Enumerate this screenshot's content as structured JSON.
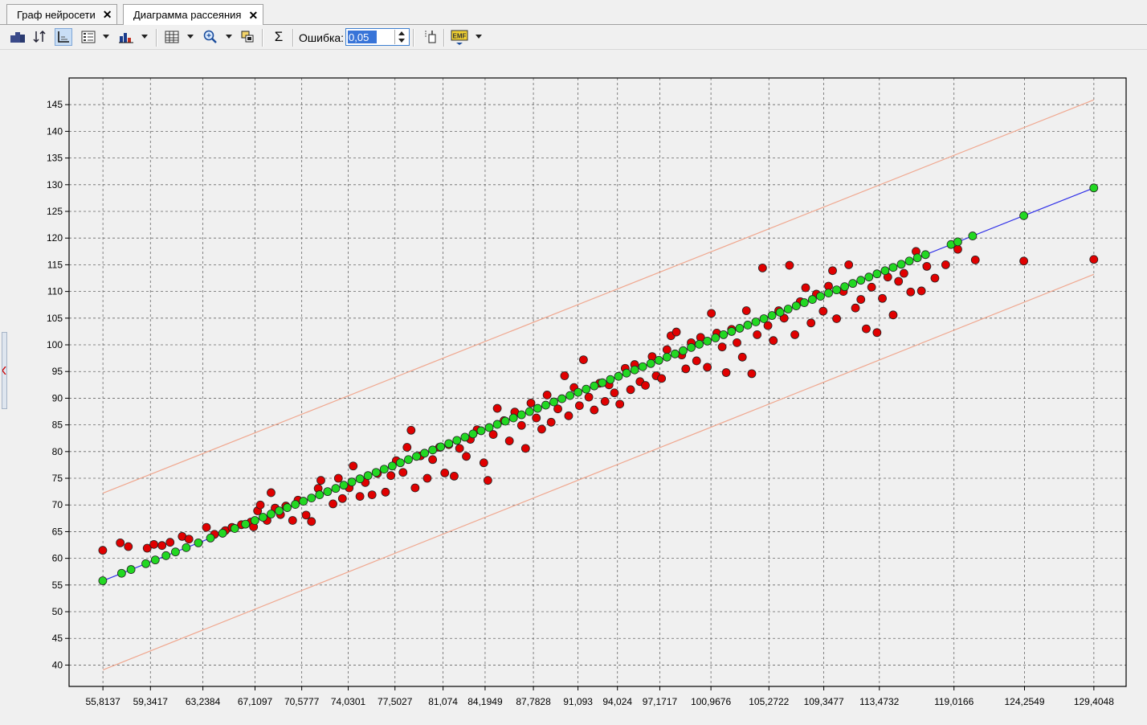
{
  "tabs": [
    {
      "label": "Граф нейросети",
      "close": "✕"
    },
    {
      "label": "Диаграмма рассеяния",
      "close": "✕"
    }
  ],
  "toolbar": {
    "icons": [
      "network-icon",
      "sort-icon",
      "axes-icon",
      "list-view-icon",
      "bar-chart-icon",
      "table-icon",
      "zoom-icon",
      "layers-icon",
      "sigma-icon",
      "pointer-icon",
      "emf-export-icon"
    ],
    "sigma": "Σ",
    "error_label": "Ошибка:",
    "error_value": "0,05",
    "emf": "EMF"
  },
  "colors": {
    "actual_point": "#e00000",
    "predicted_point": "#22d822",
    "regression_line": "#3030e8",
    "confidence_band": "#f0a890",
    "plot_bg": "#f0f0f0",
    "grid": "#666666"
  },
  "chart_data": {
    "type": "scatter",
    "title": "",
    "xlabel": "",
    "ylabel": "",
    "grid": true,
    "legend": "none",
    "ylim": [
      36,
      150
    ],
    "xlim": [
      53.3,
      131.8
    ],
    "y_ticks": [
      40,
      45,
      50,
      55,
      60,
      65,
      70,
      75,
      80,
      85,
      90,
      95,
      100,
      105,
      110,
      115,
      120,
      125,
      130,
      135,
      140,
      145
    ],
    "x_ticks": [
      {
        "label": "55,8137",
        "value": 55.8137
      },
      {
        "label": "59,3417",
        "value": 59.3417
      },
      {
        "label": "63,2384",
        "value": 63.2384
      },
      {
        "label": "67,1097",
        "value": 67.1097
      },
      {
        "label": "70,5777",
        "value": 70.5777
      },
      {
        "label": "74,0301",
        "value": 74.0301
      },
      {
        "label": "77,5027",
        "value": 77.5027
      },
      {
        "label": "81,074",
        "value": 81.074
      },
      {
        "label": "84,1949",
        "value": 84.1949
      },
      {
        "label": "87,7828",
        "value": 87.7828
      },
      {
        "label": "91,093",
        "value": 91.093
      },
      {
        "label": "94,024",
        "value": 94.024
      },
      {
        "label": "97,1717",
        "value": 97.1717
      },
      {
        "label": "100,9676",
        "value": 100.9676
      },
      {
        "label": "105,2722",
        "value": 105.2722
      },
      {
        "label": "109,3477",
        "value": 109.3477
      },
      {
        "label": "113,4732",
        "value": 113.4732
      },
      {
        "label": "119,0166",
        "value": 119.0166
      },
      {
        "label": "124,2549",
        "value": 124.2549
      },
      {
        "label": "129,4048",
        "value": 129.4048
      }
    ],
    "regression_line": [
      [
        55.8137,
        55.8
      ],
      [
        129.4048,
        129.4
      ]
    ],
    "upper_band": [
      [
        55.8137,
        72.2
      ],
      [
        129.4048,
        145.9
      ]
    ],
    "lower_band": [
      [
        55.8137,
        39.1
      ],
      [
        129.4048,
        113.2
      ]
    ],
    "series": [
      {
        "role": "actual",
        "color": "#e00000",
        "points": [
          [
            55.8,
            61.5
          ],
          [
            57.1,
            62.9
          ],
          [
            57.7,
            62.2
          ],
          [
            59.1,
            61.9
          ],
          [
            59.6,
            62.6
          ],
          [
            60.2,
            62.4
          ],
          [
            60.8,
            63.0
          ],
          [
            61.7,
            64.1
          ],
          [
            62.2,
            63.6
          ],
          [
            63.5,
            65.8
          ],
          [
            64.1,
            64.5
          ],
          [
            64.9,
            65.2
          ],
          [
            65.4,
            65.8
          ],
          [
            66.1,
            66.3
          ],
          [
            66.8,
            66.8
          ],
          [
            67.0,
            65.9
          ],
          [
            67.3,
            68.9
          ],
          [
            67.5,
            70.0
          ],
          [
            68.0,
            67.1
          ],
          [
            68.3,
            72.3
          ],
          [
            68.6,
            69.4
          ],
          [
            69.0,
            68.2
          ],
          [
            69.4,
            69.8
          ],
          [
            69.9,
            67.1
          ],
          [
            70.3,
            70.9
          ],
          [
            70.9,
            68.1
          ],
          [
            71.3,
            66.9
          ],
          [
            71.8,
            73.1
          ],
          [
            72.0,
            74.6
          ],
          [
            72.9,
            70.2
          ],
          [
            73.3,
            75.0
          ],
          [
            73.6,
            71.2
          ],
          [
            74.1,
            73.2
          ],
          [
            74.4,
            77.3
          ],
          [
            74.9,
            71.6
          ],
          [
            75.3,
            74.2
          ],
          [
            75.8,
            71.9
          ],
          [
            76.2,
            75.9
          ],
          [
            76.8,
            72.4
          ],
          [
            77.2,
            75.5
          ],
          [
            77.6,
            78.3
          ],
          [
            78.1,
            76.1
          ],
          [
            78.4,
            80.8
          ],
          [
            78.7,
            84.0
          ],
          [
            79.0,
            73.2
          ],
          [
            79.4,
            79.2
          ],
          [
            79.9,
            75.0
          ],
          [
            80.3,
            78.5
          ],
          [
            80.8,
            80.8
          ],
          [
            81.2,
            76.0
          ],
          [
            81.5,
            81.3
          ],
          [
            81.9,
            75.4
          ],
          [
            82.3,
            80.6
          ],
          [
            82.8,
            79.1
          ],
          [
            83.1,
            82.3
          ],
          [
            83.6,
            84.1
          ],
          [
            84.1,
            77.9
          ],
          [
            84.4,
            74.6
          ],
          [
            84.8,
            83.2
          ],
          [
            85.1,
            88.1
          ],
          [
            85.6,
            85.8
          ],
          [
            86.0,
            82.0
          ],
          [
            86.4,
            87.4
          ],
          [
            86.9,
            84.9
          ],
          [
            87.2,
            80.6
          ],
          [
            87.6,
            89.1
          ],
          [
            88.0,
            86.3
          ],
          [
            88.4,
            84.2
          ],
          [
            88.8,
            90.6
          ],
          [
            89.1,
            85.5
          ],
          [
            89.6,
            88.0
          ],
          [
            90.1,
            94.2
          ],
          [
            90.4,
            86.7
          ],
          [
            90.8,
            92.0
          ],
          [
            91.2,
            88.6
          ],
          [
            91.5,
            97.2
          ],
          [
            91.9,
            90.2
          ],
          [
            92.3,
            87.8
          ],
          [
            92.7,
            92.8
          ],
          [
            93.1,
            89.4
          ],
          [
            93.4,
            92.5
          ],
          [
            93.8,
            91.0
          ],
          [
            94.2,
            88.9
          ],
          [
            94.6,
            95.6
          ],
          [
            95.0,
            91.6
          ],
          [
            95.3,
            96.3
          ],
          [
            95.7,
            93.1
          ],
          [
            96.1,
            92.4
          ],
          [
            96.6,
            97.8
          ],
          [
            96.9,
            94.2
          ],
          [
            97.3,
            93.7
          ],
          [
            97.7,
            99.1
          ],
          [
            98.0,
            101.7
          ],
          [
            98.4,
            102.4
          ],
          [
            98.8,
            98.1
          ],
          [
            99.1,
            95.5
          ],
          [
            99.5,
            100.4
          ],
          [
            99.9,
            97.0
          ],
          [
            100.2,
            101.4
          ],
          [
            100.7,
            95.8
          ],
          [
            101.0,
            105.9
          ],
          [
            101.4,
            102.2
          ],
          [
            101.8,
            99.6
          ],
          [
            102.1,
            94.8
          ],
          [
            102.5,
            102.9
          ],
          [
            102.9,
            100.4
          ],
          [
            103.3,
            97.7
          ],
          [
            103.6,
            106.4
          ],
          [
            104.0,
            94.6
          ],
          [
            104.4,
            101.9
          ],
          [
            104.8,
            114.4
          ],
          [
            105.2,
            103.6
          ],
          [
            105.6,
            100.8
          ],
          [
            106.0,
            106.4
          ],
          [
            106.4,
            105.0
          ],
          [
            106.8,
            114.9
          ],
          [
            107.2,
            101.9
          ],
          [
            107.6,
            108.1
          ],
          [
            108.0,
            110.7
          ],
          [
            108.4,
            104.1
          ],
          [
            108.8,
            109.5
          ],
          [
            109.3,
            106.3
          ],
          [
            109.7,
            111.0
          ],
          [
            110.0,
            113.9
          ],
          [
            110.3,
            104.9
          ],
          [
            110.8,
            110.0
          ],
          [
            111.2,
            115.0
          ],
          [
            111.7,
            106.9
          ],
          [
            112.1,
            108.5
          ],
          [
            112.5,
            103.0
          ],
          [
            112.9,
            110.8
          ],
          [
            113.3,
            102.3
          ],
          [
            113.7,
            108.7
          ],
          [
            114.1,
            112.7
          ],
          [
            114.5,
            105.6
          ],
          [
            114.9,
            111.9
          ],
          [
            115.3,
            113.4
          ],
          [
            115.8,
            109.9
          ],
          [
            116.2,
            117.5
          ],
          [
            116.6,
            110.1
          ],
          [
            117.0,
            114.7
          ],
          [
            117.6,
            112.5
          ],
          [
            118.4,
            115.0
          ],
          [
            119.3,
            117.9
          ],
          [
            120.6,
            115.9
          ],
          [
            124.2,
            115.7
          ],
          [
            129.4,
            116.0
          ]
        ]
      },
      {
        "role": "predicted",
        "color": "#22d822",
        "points": [
          [
            55.8,
            55.8
          ],
          [
            57.2,
            57.2
          ],
          [
            57.9,
            57.9
          ],
          [
            59.0,
            59.0
          ],
          [
            59.7,
            59.7
          ],
          [
            60.5,
            60.5
          ],
          [
            61.2,
            61.2
          ],
          [
            62.0,
            62.0
          ],
          [
            62.9,
            62.9
          ],
          [
            63.8,
            63.8
          ],
          [
            64.7,
            64.7
          ],
          [
            65.6,
            65.6
          ],
          [
            66.4,
            66.4
          ],
          [
            67.1,
            67.1
          ],
          [
            67.7,
            67.7
          ],
          [
            68.3,
            68.3
          ],
          [
            68.9,
            68.9
          ],
          [
            69.5,
            69.5
          ],
          [
            70.1,
            70.1
          ],
          [
            70.7,
            70.7
          ],
          [
            71.3,
            71.3
          ],
          [
            71.9,
            71.9
          ],
          [
            72.5,
            72.5
          ],
          [
            73.1,
            73.1
          ],
          [
            73.7,
            73.7
          ],
          [
            74.3,
            74.3
          ],
          [
            74.9,
            74.9
          ],
          [
            75.5,
            75.5
          ],
          [
            76.1,
            76.1
          ],
          [
            76.7,
            76.7
          ],
          [
            77.3,
            77.3
          ],
          [
            77.9,
            77.9
          ],
          [
            78.5,
            78.5
          ],
          [
            79.1,
            79.1
          ],
          [
            79.7,
            79.7
          ],
          [
            80.3,
            80.3
          ],
          [
            80.9,
            80.9
          ],
          [
            81.5,
            81.5
          ],
          [
            82.1,
            82.1
          ],
          [
            82.7,
            82.7
          ],
          [
            83.3,
            83.3
          ],
          [
            83.9,
            83.9
          ],
          [
            84.5,
            84.5
          ],
          [
            85.1,
            85.1
          ],
          [
            85.7,
            85.7
          ],
          [
            86.3,
            86.3
          ],
          [
            86.9,
            86.9
          ],
          [
            87.5,
            87.5
          ],
          [
            88.1,
            88.1
          ],
          [
            88.7,
            88.7
          ],
          [
            89.3,
            89.3
          ],
          [
            89.9,
            89.9
          ],
          [
            90.5,
            90.5
          ],
          [
            91.1,
            91.1
          ],
          [
            91.7,
            91.7
          ],
          [
            92.3,
            92.3
          ],
          [
            92.9,
            92.9
          ],
          [
            93.5,
            93.5
          ],
          [
            94.1,
            94.1
          ],
          [
            94.7,
            94.7
          ],
          [
            95.3,
            95.3
          ],
          [
            95.9,
            95.9
          ],
          [
            96.5,
            96.5
          ],
          [
            97.1,
            97.1
          ],
          [
            97.7,
            97.7
          ],
          [
            98.3,
            98.3
          ],
          [
            98.9,
            98.9
          ],
          [
            99.5,
            99.5
          ],
          [
            100.1,
            100.1
          ],
          [
            100.7,
            100.7
          ],
          [
            101.3,
            101.3
          ],
          [
            101.9,
            101.9
          ],
          [
            102.5,
            102.5
          ],
          [
            103.1,
            103.1
          ],
          [
            103.7,
            103.7
          ],
          [
            104.3,
            104.3
          ],
          [
            104.9,
            104.9
          ],
          [
            105.5,
            105.5
          ],
          [
            106.1,
            106.1
          ],
          [
            106.7,
            106.7
          ],
          [
            107.3,
            107.3
          ],
          [
            107.9,
            107.9
          ],
          [
            108.5,
            108.5
          ],
          [
            109.1,
            109.1
          ],
          [
            109.7,
            109.7
          ],
          [
            110.3,
            110.3
          ],
          [
            110.9,
            110.9
          ],
          [
            111.5,
            111.5
          ],
          [
            112.1,
            112.1
          ],
          [
            112.7,
            112.7
          ],
          [
            113.3,
            113.3
          ],
          [
            113.9,
            113.9
          ],
          [
            114.5,
            114.5
          ],
          [
            115.1,
            115.1
          ],
          [
            115.7,
            115.7
          ],
          [
            116.3,
            116.3
          ],
          [
            116.9,
            116.9
          ],
          [
            118.8,
            118.8
          ],
          [
            119.3,
            119.3
          ],
          [
            120.4,
            120.4
          ],
          [
            124.2,
            124.2
          ],
          [
            129.4,
            129.4
          ]
        ]
      }
    ]
  }
}
